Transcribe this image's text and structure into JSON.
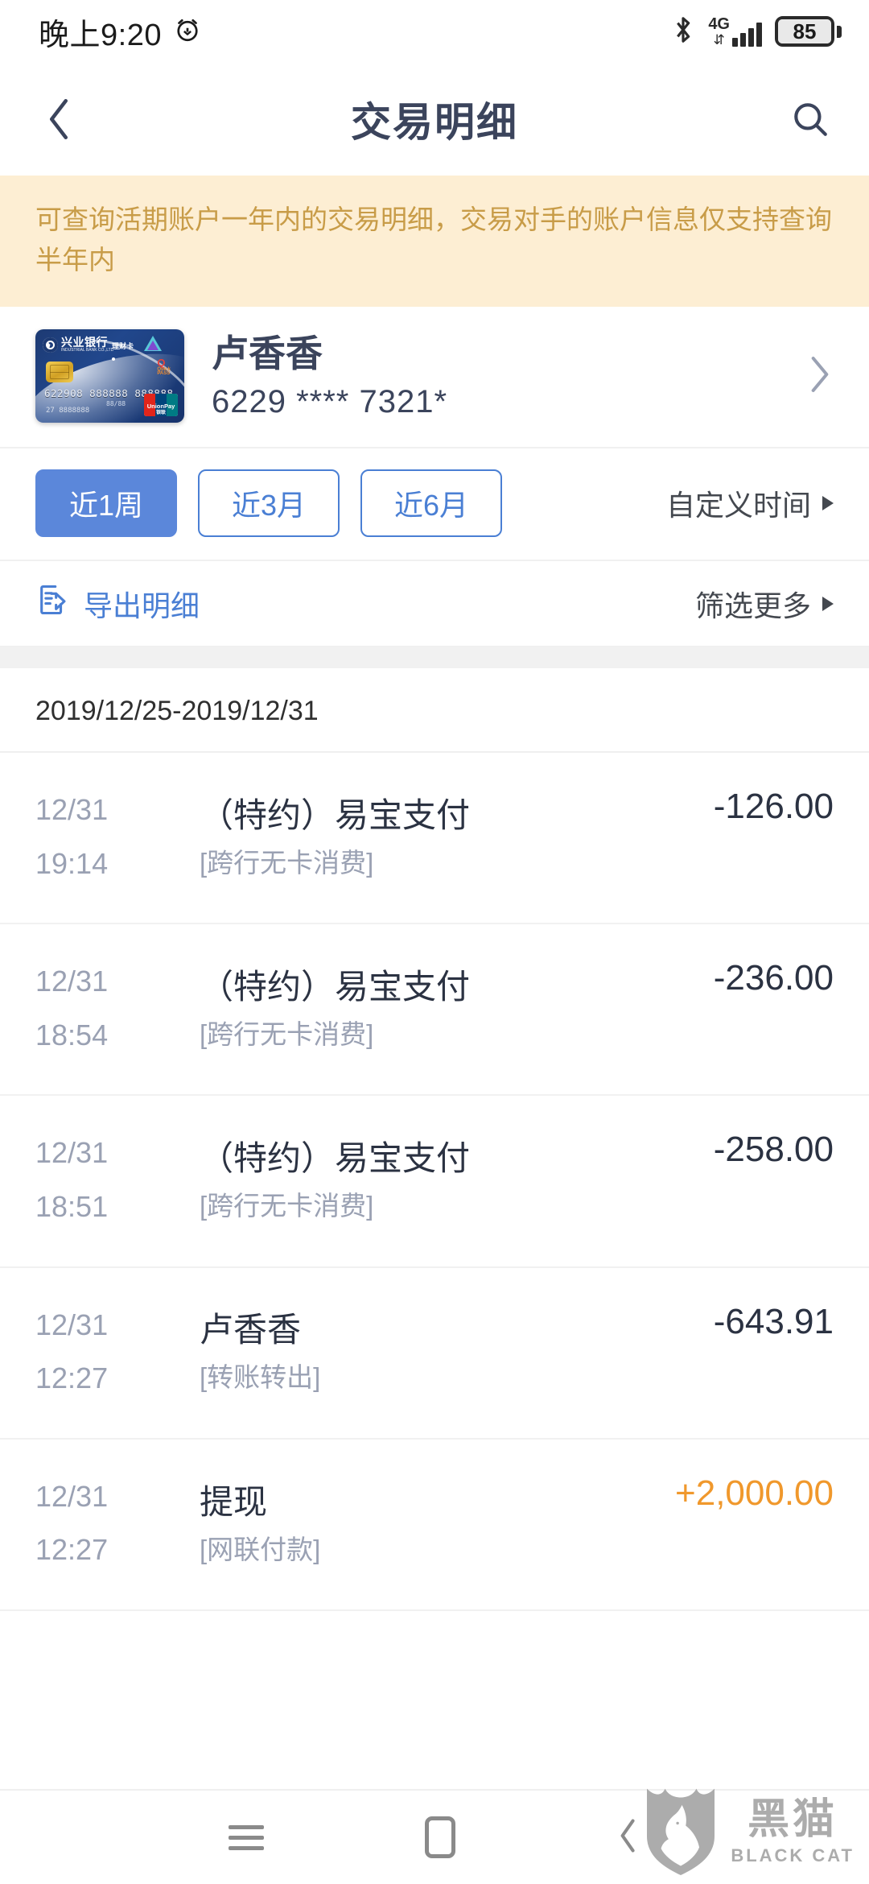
{
  "status_bar": {
    "time": "晚上9:20",
    "alarm_icon": "alarm-icon",
    "bluetooth_icon": "bluetooth-icon",
    "network_label": "4G",
    "data_arrows": "⇵",
    "battery_level": "85"
  },
  "header": {
    "back_icon": "chevron-left-icon",
    "title": "交易明细",
    "search_icon": "search-icon"
  },
  "notice": {
    "text": "可查询活期账户一年内的交易明细，交易对手的账户信息仅支持查询半年内",
    "bg_color": "#fdeed3",
    "text_color": "#c89c48"
  },
  "card": {
    "bank_name_cn": "兴业银行",
    "bank_name_en": "INDUSTRIAL BANK CO.,LTD",
    "card_type": "理财卡",
    "quickpass_label": "Quick",
    "quickpass_sub": "PASS",
    "unionpay_label": "UnionPay",
    "unionpay_sub": "银联",
    "embossed_number": "622908  888888  888888",
    "expiry": "88/88",
    "embossed_secondary": "27  8888888",
    "holder_name": "卢香香",
    "masked_number": "6229 **** 7321*",
    "chevron_icon": "chevron-right-icon"
  },
  "filters": {
    "chips": [
      {
        "label": "近1周",
        "active": true
      },
      {
        "label": "近3月",
        "active": false
      },
      {
        "label": "近6月",
        "active": false
      }
    ],
    "custom_time_label": "自定义时间",
    "custom_time_icon": "triangle-right-icon",
    "active_color": "#5b87da",
    "outline_color": "#4a7fd4"
  },
  "actions": {
    "export_icon": "export-document-icon",
    "export_label": "导出明细",
    "more_filter_label": "筛选更多",
    "more_filter_icon": "triangle-right-icon"
  },
  "list": {
    "date_range": "2019/12/25-2019/12/31",
    "transactions": [
      {
        "date": "12/31",
        "time": "19:14",
        "title": "（特约）易宝支付",
        "subtitle": "[跨行无卡消费]",
        "amount": "-126.00",
        "type": "debit"
      },
      {
        "date": "12/31",
        "time": "18:54",
        "title": "（特约）易宝支付",
        "subtitle": "[跨行无卡消费]",
        "amount": "-236.00",
        "type": "debit"
      },
      {
        "date": "12/31",
        "time": "18:51",
        "title": "（特约）易宝支付",
        "subtitle": "[跨行无卡消费]",
        "amount": "-258.00",
        "type": "debit"
      },
      {
        "date": "12/31",
        "time": "12:27",
        "title": "卢香香",
        "subtitle": "[转账转出]",
        "amount": "-643.91",
        "type": "debit"
      },
      {
        "date": "12/31",
        "time": "12:27",
        "title": "提现",
        "subtitle": "[网联付款]",
        "amount": "+2,000.00",
        "type": "credit"
      }
    ],
    "credit_color": "#f0982c",
    "debit_color": "#2b3242"
  },
  "navbar": {
    "recents_icon": "recents-icon",
    "home_icon": "home-icon",
    "back_icon": "chevron-left-icon"
  },
  "watermark": {
    "logo_icon": "black-cat-shield-icon",
    "name_cn": "黑猫",
    "name_en": "BLACK CAT"
  }
}
